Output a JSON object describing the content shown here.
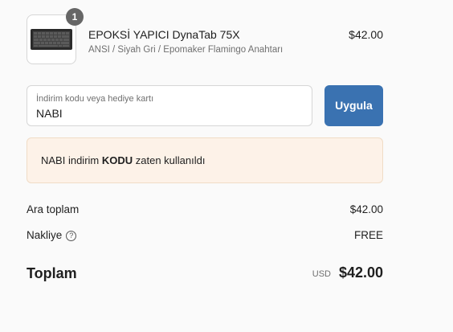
{
  "product": {
    "quantity": "1",
    "title": "EPOKSİ YAPICI DynaTab 75X",
    "variant": "ANSI / Siyah Gri / Epomaker Flamingo Anahtarı",
    "price": "$42.00",
    "image_icon": "keyboard-image"
  },
  "discount": {
    "label": "İndirim kodu veya hediye kartı",
    "value": "NABI",
    "apply_label": "Uygula",
    "apply_color": "#3a72b1"
  },
  "alert": {
    "prefix": "NABI indirim ",
    "bold": "KODU",
    "suffix": " zaten kullanıldı",
    "bg_color": "#fdf2e8"
  },
  "summary": {
    "subtotal_label": "Ara toplam",
    "subtotal_value": "$42.00",
    "shipping_label": "Nakliye",
    "shipping_value": "FREE",
    "help_icon": "question-circle-icon",
    "total_label": "Toplam",
    "currency": "USD",
    "total_value": "$42.00"
  }
}
